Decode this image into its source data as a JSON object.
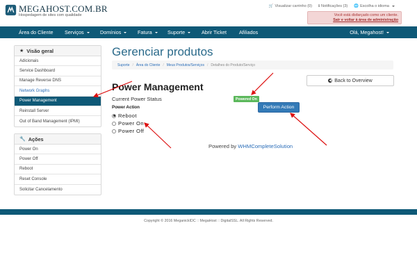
{
  "header": {
    "logo_name": "MEGAHOST.COM.BR",
    "logo_tagline": "Hospedagem de sites com qualidade",
    "top_links": {
      "cart": "Visualizar carrinho (0)",
      "notifications": "Notificações (3)",
      "language": "Escolha o idioma"
    },
    "disguise_text": "Você está disfarçado como um cliente.",
    "disguise_link": "Sair e voltar à área de administração"
  },
  "nav": {
    "items": [
      "Área do Cliente",
      "Serviços",
      "Domínios",
      "Fatura",
      "Suporte",
      "Abrir Ticket",
      "Afiliados"
    ],
    "user": "Olá, Megahost!"
  },
  "sidebar": {
    "overview_title": "Visão geral",
    "overview_items": [
      "Adicionais",
      "Service Dashboard",
      "Manage Reverse DNS",
      "Network Graphs",
      "Power Management",
      "Reinstall Server",
      "Out of Band Management (IPMI)"
    ],
    "actions_title": "Ações",
    "action_items": [
      "Power On",
      "Power Off",
      "Reboot",
      "Reset Console",
      "Solicitar Cancelamento"
    ]
  },
  "main": {
    "page_title": "Gerenciar produtos",
    "breadcrumb": [
      "Suporte",
      "Área do Cliente",
      "Meus Produtos/Serviços",
      "Detalhes do Produto/Serviço"
    ],
    "back_button": "Back to Overview",
    "section_title": "Power Management",
    "current_status_label": "Current Power Status",
    "status_badge": "Powered On",
    "power_action_label": "Power Action",
    "options": [
      "Reboot",
      "Power On",
      "Power Off"
    ],
    "selected_option": "Reboot",
    "perform_button": "Perform Action",
    "powered_by_prefix": "Powered by",
    "powered_by_link": "WHMCompleteSolution"
  },
  "footer": {
    "copyright": "Copyright © 2016 MeganickIDC :: MegaHost :: DigitalSSL. All Rights Reserved."
  },
  "colors": {
    "brand": "#0e5977",
    "link": "#2a6db8",
    "success": "#5cb85c",
    "primary_button": "#337ab7",
    "annotation_arrow": "#dd1111"
  }
}
